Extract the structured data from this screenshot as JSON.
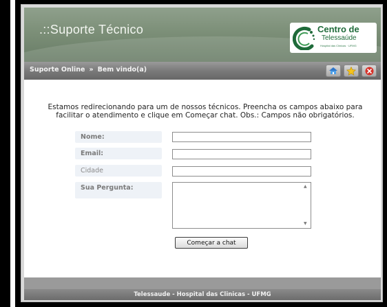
{
  "header": {
    "title": ".::Suporte Técnico",
    "logo": {
      "line1": "Centro de",
      "line2": "Telessaúde",
      "line3": "Hospital das Clínicas · UFMG"
    }
  },
  "nav": {
    "breadcrumb": [
      "Suporte Online",
      "»",
      "Bem vindo(a)"
    ],
    "icons": [
      "home-icon",
      "star-icon",
      "close-icon"
    ]
  },
  "main": {
    "intro": "Estamos redirecionando para um de nossos técnicos. Preencha os campos abaixo para facilitar o atendimento e clique em Começar chat. Obs.: Campos não obrigatórios.",
    "form": {
      "name_label": "Nome:",
      "email_label": "Email:",
      "city_label": "Cidade",
      "question_label": "Sua Pergunta:",
      "name_value": "",
      "email_value": "",
      "city_value": "",
      "question_value": "",
      "submit_label": "Começar a chat"
    }
  },
  "footer": {
    "text": "Telessaude - Hospital das Clinicas - UFMG"
  },
  "colors": {
    "header_green": "#7c8f78",
    "navbar_gray": "#7a7a7a",
    "logo_green": "#1f6b3a",
    "label_background": "#eef2f7"
  }
}
